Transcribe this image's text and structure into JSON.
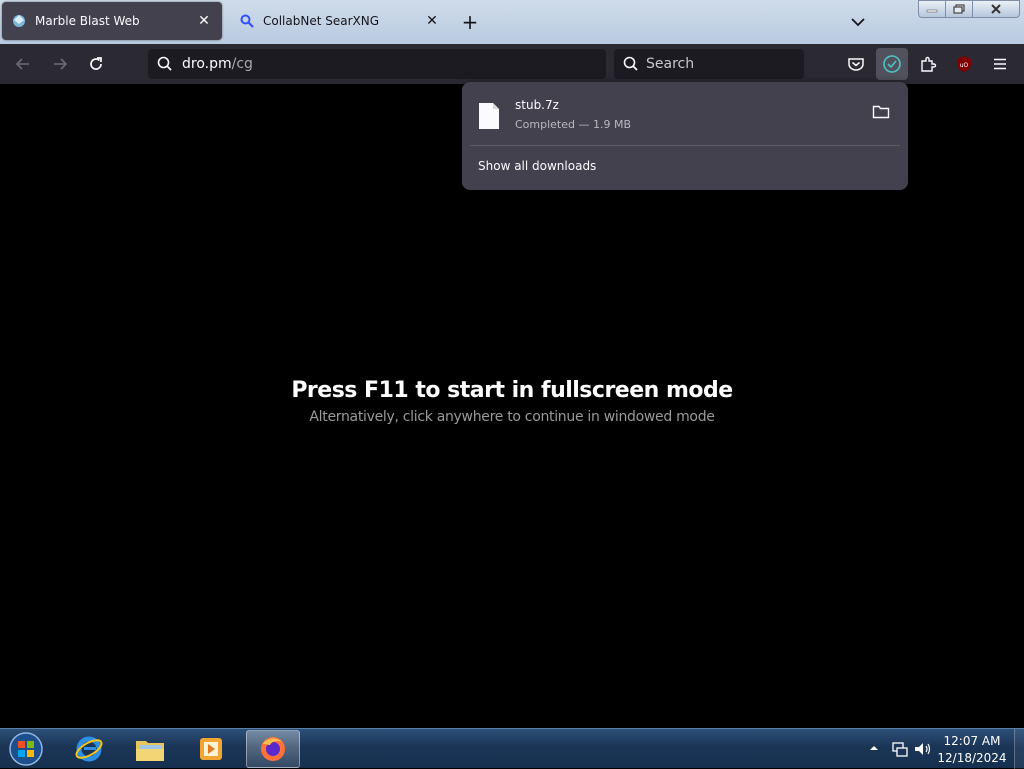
{
  "browser": {
    "tabs": [
      {
        "label": "Marble Blast Web",
        "active": true,
        "icon": "marble-icon"
      },
      {
        "label": "CollabNet SearXNG",
        "active": false,
        "icon": "magnifier-icon"
      }
    ],
    "new_tab_label": "+",
    "url": {
      "host": "dro.pm",
      "path": "/cg"
    },
    "search_placeholder": "Search"
  },
  "downloads_panel": {
    "filename": "stub.7z",
    "status": "Completed — 1.9 MB",
    "show_all": "Show all downloads"
  },
  "page": {
    "title": "Press F11 to start in fullscreen mode",
    "subtitle": "Alternatively, click anywhere to continue in windowed mode"
  },
  "taskbar": {
    "time": "12:07 AM",
    "date": "12/18/2024",
    "pinned": [
      "internet-explorer-icon",
      "file-explorer-icon",
      "media-player-icon",
      "firefox-icon"
    ]
  },
  "colors": {
    "toolbar": "#2b2a33",
    "panel": "#42414d",
    "accent_check": "#4dc3c6"
  }
}
